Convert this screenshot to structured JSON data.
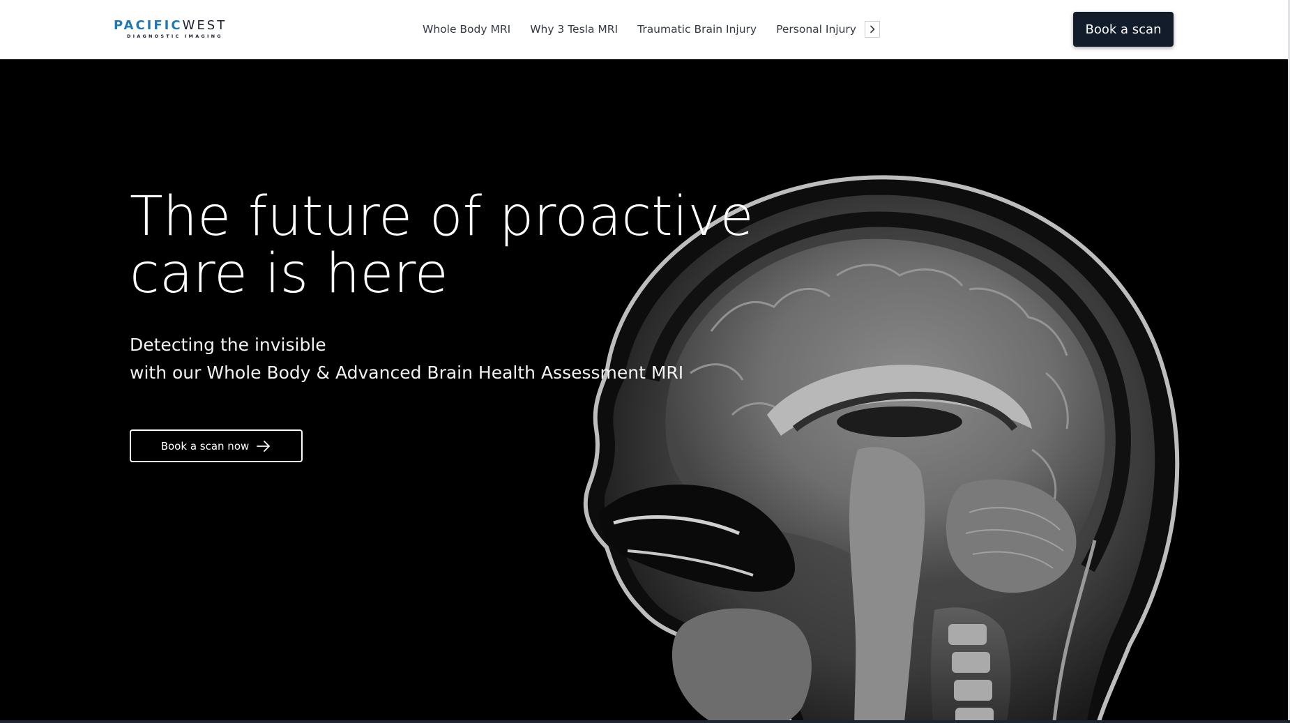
{
  "header": {
    "logo": {
      "pacific": "PACIFIC",
      "west": "WEST",
      "tagline": "DIAGNOSTIC IMAGING"
    },
    "nav": {
      "items": [
        {
          "label": "Whole Body MRI"
        },
        {
          "label": "Why 3 Tesla MRI"
        },
        {
          "label": "Traumatic Brain Injury"
        },
        {
          "label": "Personal Injury"
        }
      ],
      "next_icon": "chevron-right-icon"
    },
    "book_button_label": "Book a scan"
  },
  "hero": {
    "title_line1": "The future of proactive",
    "title_line2": "care is here",
    "subtitle_line1": "Detecting the invisible",
    "subtitle_line2": "with our Whole Body & Advanced Brain Health Assessment MRI",
    "cta_label": "Book a scan now",
    "cta_icon": "arrow-right-icon",
    "image_description_icon": "mri-brain-scan-image"
  },
  "colors": {
    "brand_blue": "#1e78b8",
    "navy": "#121c2b",
    "hero_bg": "#000000",
    "header_bg": "#ffffff"
  }
}
